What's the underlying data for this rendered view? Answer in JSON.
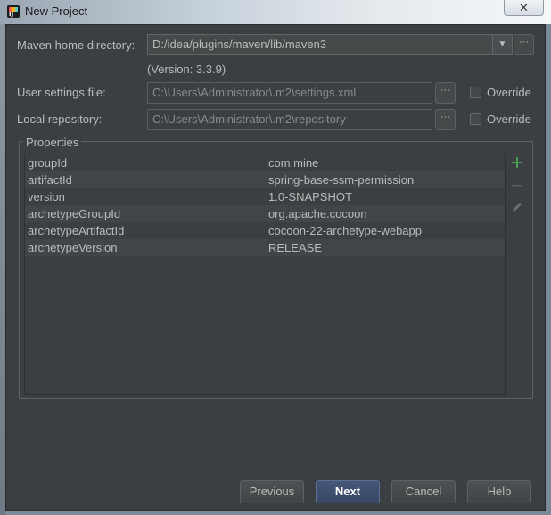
{
  "window": {
    "title": "New Project",
    "close_glyph": "✕"
  },
  "maven_home": {
    "label": "Maven home directory:",
    "value": "D:/idea/plugins/maven/lib/maven3",
    "version": "(Version: 3.3.9)"
  },
  "user_settings": {
    "label": "User settings file:",
    "value": "C:\\Users\\Administrator\\.m2\\settings.xml",
    "override_label": "Override",
    "override_checked": false
  },
  "local_repo": {
    "label": "Local repository:",
    "value": "C:\\Users\\Administrator\\.m2\\repository",
    "override_label": "Override",
    "override_checked": false
  },
  "browse_glyph": "···",
  "combo_glyph": "▼",
  "properties": {
    "legend": "Properties",
    "rows": [
      {
        "key": "groupId",
        "value": "com.mine"
      },
      {
        "key": "artifactId",
        "value": "spring-base-ssm-permission"
      },
      {
        "key": "version",
        "value": "1.0-SNAPSHOT"
      },
      {
        "key": "archetypeGroupId",
        "value": "org.apache.cocoon"
      },
      {
        "key": "archetypeArtifactId",
        "value": "cocoon-22-archetype-webapp"
      },
      {
        "key": "archetypeVersion",
        "value": "RELEASE"
      }
    ],
    "toolbar": {
      "add_icon": "plus-icon",
      "remove_icon": "minus-icon",
      "edit_icon": "pencil-icon"
    }
  },
  "buttons": {
    "previous": "Previous",
    "next": "Next",
    "cancel": "Cancel",
    "help": "Help"
  },
  "colors": {
    "dialog_bg": "#3c3f41",
    "text": "#bbbbbb",
    "accent_add": "#499c54",
    "default_button": "#384766"
  }
}
